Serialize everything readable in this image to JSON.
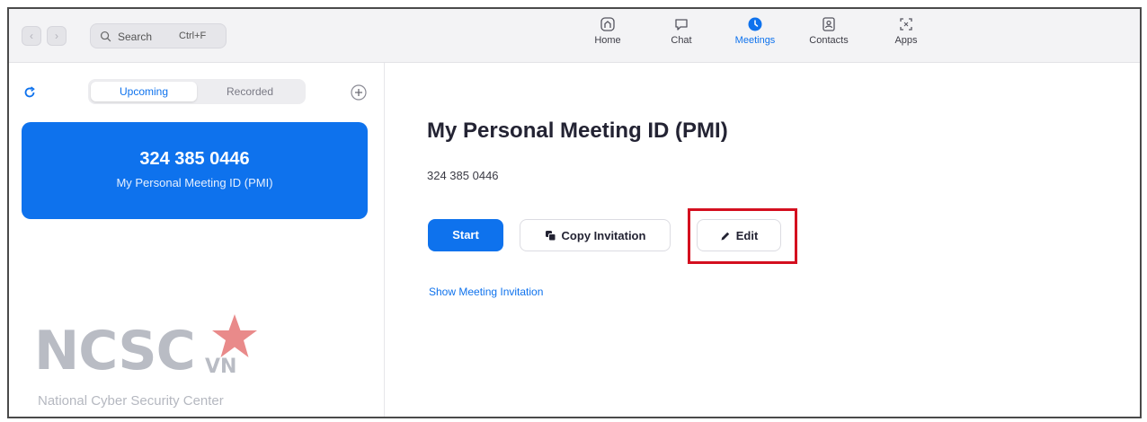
{
  "toolbar": {
    "search_label": "Search",
    "search_shortcut": "Ctrl+F"
  },
  "nav": {
    "items": [
      {
        "label": "Home",
        "icon": "home-icon"
      },
      {
        "label": "Chat",
        "icon": "chat-icon"
      },
      {
        "label": "Meetings",
        "icon": "meetings-icon",
        "active": true
      },
      {
        "label": "Contacts",
        "icon": "contacts-icon"
      },
      {
        "label": "Apps",
        "icon": "apps-icon"
      }
    ]
  },
  "sidebar": {
    "tabs": [
      {
        "label": "Upcoming",
        "active": true
      },
      {
        "label": "Recorded"
      }
    ],
    "pmi_card": {
      "number": "324 385 0446",
      "label": "My Personal Meeting ID (PMI)"
    }
  },
  "watermark": {
    "brand": "NCSC",
    "suffix": "VN",
    "subtitle": "National Cyber Security Center"
  },
  "main": {
    "title": "My Personal Meeting ID (PMI)",
    "meeting_id": "324 385 0446",
    "buttons": {
      "start": "Start",
      "copy": "Copy Invitation",
      "edit": "Edit"
    },
    "show_invitation": "Show Meeting Invitation"
  },
  "colors": {
    "accent": "#0e72ed",
    "highlight": "#d40f1f",
    "watermark": "#b9bcc4",
    "star": "#e98a8a"
  }
}
